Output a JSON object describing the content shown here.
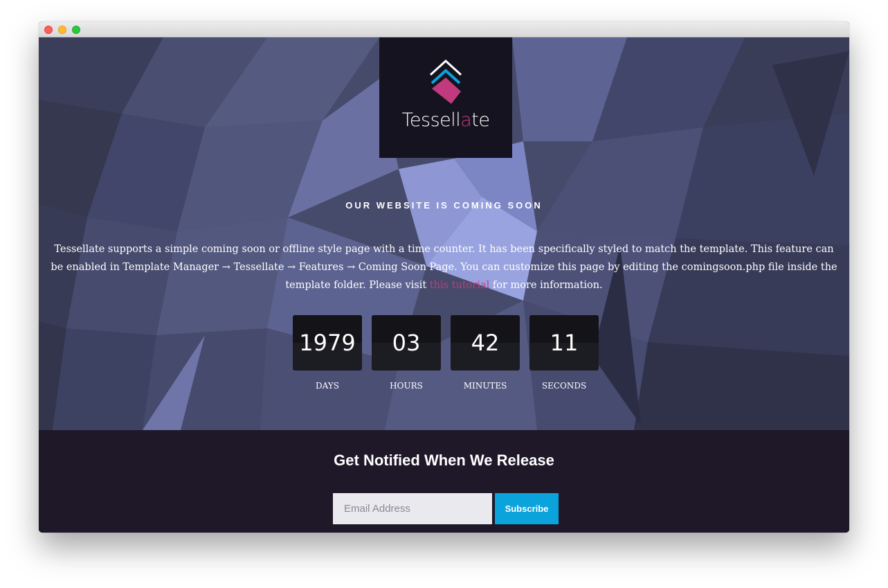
{
  "window": {
    "controls": [
      "close",
      "minimize",
      "zoom"
    ]
  },
  "logo": {
    "text_pre": "Tessell",
    "text_accent": "a",
    "text_post": "te",
    "icon": "stacked-diamond-logo-icon"
  },
  "hero": {
    "title": "OUR WEBSITE IS COMING SOON",
    "description_before": "Tessellate supports a simple coming soon or offline style page with a time counter. It has been specifically styled to match the template. This feature can be enabled in Template Manager → Tessellate → Features → Coming Soon Page. You can customize this page by editing the comingsoon.php file inside the template folder. Please visit ",
    "link_text": "this tutorial",
    "description_after": " for more information."
  },
  "countdown": {
    "days": {
      "value": "1979",
      "label": "DAYS"
    },
    "hours": {
      "value": "03",
      "label": "HOURS"
    },
    "minutes": {
      "value": "42",
      "label": "MINUTES"
    },
    "seconds": {
      "value": "11",
      "label": "SECONDS"
    }
  },
  "notify": {
    "title": "Get Notified When We Release",
    "email_placeholder": "Email Address",
    "button_label": "Subscribe"
  },
  "colors": {
    "accent": "#c03a7d",
    "button": "#0aa3dc",
    "footer_bg": "#1e1829",
    "logo_bg": "#15131f"
  }
}
